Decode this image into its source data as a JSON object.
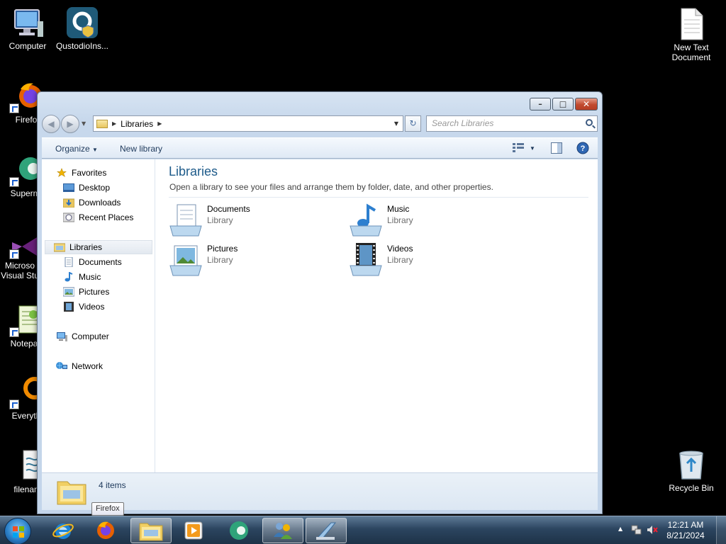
{
  "desktop": {
    "icons": [
      {
        "label": "Computer",
        "icon": "computer-icon"
      },
      {
        "label": "QustodioIns...",
        "icon": "qustodio-installer-icon"
      },
      {
        "label": "Firefo",
        "icon": "firefox-icon"
      },
      {
        "label": "Supermi",
        "icon": "supermium-icon"
      },
      {
        "label": "Microso Visual Stu",
        "icon": "visual-studio-icon"
      },
      {
        "label": "Notepac",
        "icon": "notepad-icon"
      },
      {
        "label": "Everyth",
        "icon": "everything-icon"
      },
      {
        "label": "filenan",
        "icon": "filename-script-icon"
      },
      {
        "label": "New Text Document",
        "icon": "text-document-icon"
      },
      {
        "label": "Recycle Bin",
        "icon": "recycle-bin-icon"
      }
    ]
  },
  "window": {
    "address": {
      "crumb": "Libraries"
    },
    "search_placeholder": "Search Libraries",
    "toolbar": {
      "organize": "Organize",
      "new_library": "New library"
    },
    "nav": {
      "favorites": "Favorites",
      "desktop": "Desktop",
      "downloads": "Downloads",
      "recent": "Recent Places",
      "libraries": "Libraries",
      "documents": "Documents",
      "music": "Music",
      "pictures": "Pictures",
      "videos": "Videos",
      "computer": "Computer",
      "network": "Network"
    },
    "main": {
      "title": "Libraries",
      "subtitle": "Open a library to see your files and arrange them by folder, date, and other properties.",
      "libraries": [
        {
          "name": "Documents",
          "type": "Library",
          "icon": "documents-library-icon"
        },
        {
          "name": "Music",
          "type": "Library",
          "icon": "music-library-icon"
        },
        {
          "name": "Pictures",
          "type": "Library",
          "icon": "pictures-library-icon"
        },
        {
          "name": "Videos",
          "type": "Library",
          "icon": "videos-library-icon"
        }
      ]
    },
    "details": {
      "count": "4 items"
    }
  },
  "tooltip": "Firefox",
  "taskbar": {
    "pinned": [
      "internet-explorer-icon",
      "firefox-icon",
      "windows-explorer-icon",
      "media-player-icon",
      "supermium-icon",
      "users-icon",
      "notepad-icon"
    ],
    "active": "windows-explorer-icon"
  },
  "clock": {
    "time": "12:21 AM",
    "date": "8/21/2024"
  },
  "colors": {
    "title_blue": "#1e5b8a",
    "close_red": "#c14a2f",
    "taskbar": "#2c4560"
  }
}
